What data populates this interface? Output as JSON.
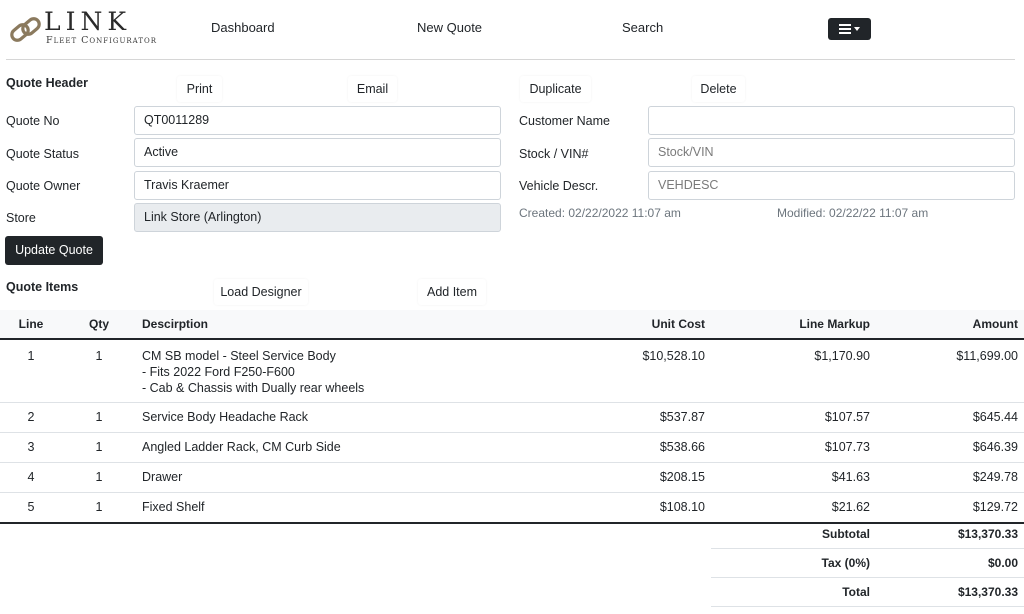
{
  "app": {
    "logo_title": "LINK",
    "logo_subtitle": "Fleet Configurator",
    "logo_icon": "chain-link-icon"
  },
  "nav": {
    "dashboard": "Dashboard",
    "new_quote": "New Quote",
    "search": "Search",
    "menu_icon": "hamburger-menu-icon"
  },
  "quote_header": {
    "title": "Quote Header",
    "actions": {
      "print": "Print",
      "email": "Email",
      "duplicate": "Duplicate",
      "delete": "Delete"
    },
    "fields": {
      "quote_no": {
        "label": "Quote No",
        "value": "QT0011289"
      },
      "quote_status": {
        "label": "Quote Status",
        "value": "Active"
      },
      "quote_owner": {
        "label": "Quote Owner",
        "value": "Travis Kraemer"
      },
      "store": {
        "label": "Store",
        "value": "Link Store (Arlington)"
      },
      "customer_name": {
        "label": "Customer Name",
        "value": ""
      },
      "stock_vin": {
        "label": "Stock / VIN#",
        "placeholder": "Stock/VIN"
      },
      "vehicle_descr": {
        "label": "Vehicle Descr.",
        "placeholder": "VEHDESC"
      }
    },
    "created": "Created: 02/22/2022 11:07 am",
    "modified": "Modified: 02/22/22 11:07 am",
    "update_button": "Update Quote"
  },
  "quote_items": {
    "title": "Quote Items",
    "actions": {
      "load_designer": "Load Designer",
      "add_item": "Add Item"
    },
    "columns": {
      "line": "Line",
      "qty": "Qty",
      "description": "Descirption",
      "unit_cost": "Unit Cost",
      "line_markup": "Line Markup",
      "amount": "Amount"
    },
    "rows": [
      {
        "line": "1",
        "qty": "1",
        "description": [
          "CM SB model - Steel Service Body",
          "- Fits 2022 Ford F250-F600",
          "- Cab & Chassis with Dually rear wheels"
        ],
        "unit_cost": "$10,528.10",
        "line_markup": "$1,170.90",
        "amount": "$11,699.00"
      },
      {
        "line": "2",
        "qty": "1",
        "description": [
          "Service Body Headache Rack"
        ],
        "unit_cost": "$537.87",
        "line_markup": "$107.57",
        "amount": "$645.44"
      },
      {
        "line": "3",
        "qty": "1",
        "description": [
          "Angled Ladder Rack, CM Curb Side"
        ],
        "unit_cost": "$538.66",
        "line_markup": "$107.73",
        "amount": "$646.39"
      },
      {
        "line": "4",
        "qty": "1",
        "description": [
          "Drawer"
        ],
        "unit_cost": "$208.15",
        "line_markup": "$41.63",
        "amount": "$249.78"
      },
      {
        "line": "5",
        "qty": "1",
        "description": [
          "Fixed Shelf"
        ],
        "unit_cost": "$108.10",
        "line_markup": "$21.62",
        "amount": "$129.72"
      }
    ]
  },
  "totals": {
    "subtotal": {
      "label": "Subtotal",
      "value": "$13,370.33"
    },
    "tax": {
      "label": "Tax (0%)",
      "value": "$0.00"
    },
    "total": {
      "label": "Total",
      "value": "$13,370.33"
    }
  },
  "colors": {
    "dark": "#212529",
    "border": "#ced4da",
    "readonly_bg": "#e9ecef",
    "muted": "#6c757d"
  }
}
